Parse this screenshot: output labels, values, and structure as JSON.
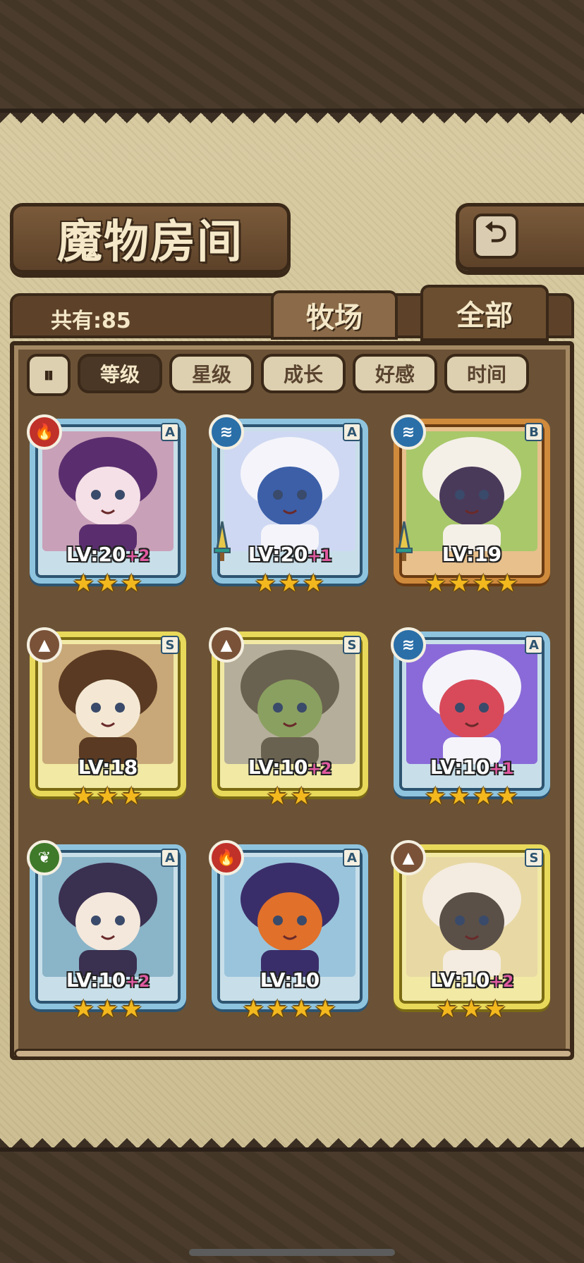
{
  "header": {
    "title": "魔物房间",
    "back_icon": "return-arrow-icon"
  },
  "summary": {
    "total": "共有:85"
  },
  "tabs": [
    {
      "label": "牧场"
    },
    {
      "label": "全部"
    }
  ],
  "filters": {
    "sort_direction_icon": "sort-toggle-icon",
    "chips": [
      {
        "label": "等级",
        "active": true
      },
      {
        "label": "星级"
      },
      {
        "label": "成长"
      },
      {
        "label": "好感"
      },
      {
        "label": "时间"
      }
    ]
  },
  "monsters": [
    {
      "element": "fire",
      "rank": "A",
      "level": "LV:20",
      "bonus": "+2",
      "stars": 3,
      "weapon": false,
      "palette": [
        "#c8a0b8",
        "#5a2e6e",
        "#f4e0e6"
      ]
    },
    {
      "element": "water",
      "rank": "A",
      "level": "LV:20",
      "bonus": "+1",
      "stars": 3,
      "weapon": true,
      "palette": [
        "#cfd8f2",
        "#f4f4fa",
        "#3c5fa8"
      ]
    },
    {
      "element": "water",
      "rank": "B",
      "level": "LV:19",
      "bonus": "",
      "stars": 4,
      "weapon": true,
      "palette": [
        "#a8c86a",
        "#f4f0e8",
        "#4a3a5a"
      ]
    },
    {
      "element": "earth",
      "rank": "S",
      "level": "LV:18",
      "bonus": "",
      "stars": 3,
      "weapon": false,
      "palette": [
        "#c8a878",
        "#5a3a22",
        "#f4e8d4"
      ]
    },
    {
      "element": "earth",
      "rank": "S",
      "level": "LV:10",
      "bonus": "+2",
      "stars": 2,
      "weapon": false,
      "palette": [
        "#b4ae9a",
        "#6a6250",
        "#8aa060"
      ]
    },
    {
      "element": "water",
      "rank": "A",
      "level": "LV:10",
      "bonus": "+1",
      "stars": 4,
      "weapon": false,
      "palette": [
        "#8a6ad8",
        "#f4f4fa",
        "#d84a5a"
      ]
    },
    {
      "element": "wood",
      "rank": "A",
      "level": "LV:10",
      "bonus": "+2",
      "stars": 3,
      "weapon": false,
      "palette": [
        "#8ab4c8",
        "#3a3050",
        "#f4e8dc"
      ]
    },
    {
      "element": "fire",
      "rank": "A",
      "level": "LV:10",
      "bonus": "",
      "stars": 4,
      "weapon": false,
      "palette": [
        "#9ac4dc",
        "#3a2e6a",
        "#e0702a"
      ]
    },
    {
      "element": "earth",
      "rank": "S",
      "level": "LV:10",
      "bonus": "+2",
      "stars": 3,
      "weapon": false,
      "palette": [
        "#e8d8a4",
        "#f4ece0",
        "#5a5048"
      ]
    }
  ],
  "element_icons": {
    "fire": "flame-icon",
    "water": "wave-icon",
    "earth": "mountain-icon",
    "wood": "leaf-icon"
  }
}
